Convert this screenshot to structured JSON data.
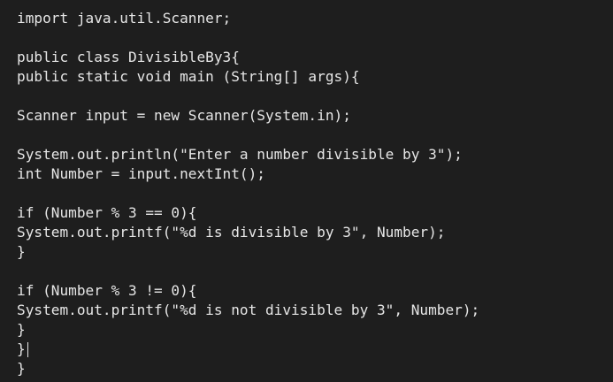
{
  "code": {
    "lines": [
      "import java.util.Scanner;",
      "",
      "public class DivisibleBy3{",
      "public static void main (String[] args){",
      "",
      "Scanner input = new Scanner(System.in);",
      "",
      "System.out.println(\"Enter a number divisible by 3\");",
      "int Number = input.nextInt();",
      "",
      "if (Number % 3 == 0){",
      "System.out.printf(\"%d is divisible by 3\", Number);",
      "}",
      "",
      "if (Number % 3 != 0){",
      "System.out.printf(\"%d is not divisible by 3\", Number);",
      "}",
      "}",
      "}"
    ]
  }
}
